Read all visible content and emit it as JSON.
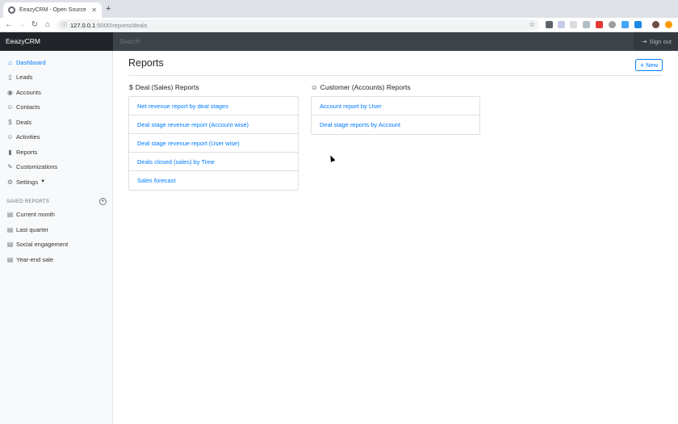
{
  "browser": {
    "tab_title": "EeazyCRM - Open Source CRM",
    "tab_close": "✕",
    "new_tab": "+",
    "url_host": "127.0.0.1",
    "url_path": ":5000/reports/deals"
  },
  "app": {
    "brand": "EeazyCRM",
    "search_placeholder": "Search",
    "signout_label": "Sign out"
  },
  "sidebar": {
    "items": [
      {
        "label": "Dashboard",
        "icon": "home-icon",
        "active": true
      },
      {
        "label": "Leads",
        "icon": "file-icon"
      },
      {
        "label": "Accounts",
        "icon": "map-pin-icon"
      },
      {
        "label": "Contacts",
        "icon": "users-icon"
      },
      {
        "label": "Deals",
        "icon": "dollar-icon"
      },
      {
        "label": "Activities",
        "icon": "users-icon"
      },
      {
        "label": "Reports",
        "icon": "bar-chart-icon"
      },
      {
        "label": "Customizations",
        "icon": "tool-icon"
      },
      {
        "label": "Settings",
        "icon": "gear-icon"
      }
    ],
    "saved_heading": "SAVED REPORTS",
    "saved": [
      {
        "label": "Current month"
      },
      {
        "label": "Last quarter"
      },
      {
        "label": "Social engagement"
      },
      {
        "label": "Year-end sale"
      }
    ]
  },
  "main": {
    "title": "Reports",
    "new_label": "New",
    "deal_section": {
      "title": "Deal (Sales) Reports",
      "items": [
        "Net revenue report by deal stages",
        "Deal stage revenue report (Account wise)",
        "Deal stage revenue report (User wise)",
        "Deals closed (sales) by Time",
        "Sales forecast"
      ]
    },
    "customer_section": {
      "title": "Customer (Accounts) Reports",
      "items": [
        "Account report by User",
        "Deal stage reports by Account"
      ]
    }
  },
  "colors": {
    "accent": "#007bff",
    "navbar": "#343a40",
    "brand_bg": "#212529"
  }
}
